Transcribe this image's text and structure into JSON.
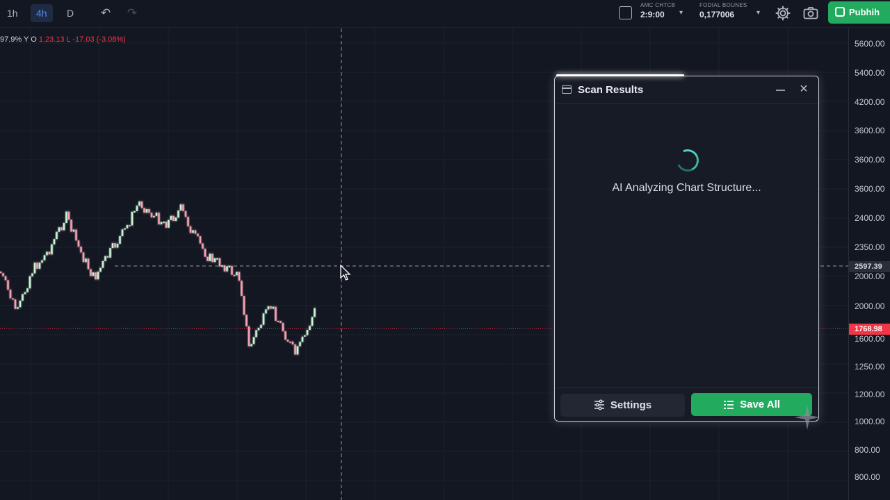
{
  "toolbar": {
    "timeframes": [
      {
        "label": "1h",
        "active": false
      },
      {
        "label": "4h",
        "active": true
      },
      {
        "label": "D",
        "active": false
      }
    ],
    "field1": {
      "label": "AMC CHTCB",
      "value": "2:9:00"
    },
    "field2": {
      "label": "FODIAL BOUNES",
      "value": "0,177006"
    },
    "publish_label": "Pubhih"
  },
  "legend": {
    "ohlc_left": "97.9% Y O",
    "ohlc_right": "1.23.13 L -17.03 (-3.08%)"
  },
  "price_axis": {
    "ticks": [
      "5600.00",
      "5400.00",
      "4200.00",
      "3600.00",
      "3600.00",
      "3600.00",
      "2400.00",
      "2350.00",
      "2000.00",
      "2000.00",
      "1600.00",
      "1250.00",
      "1200.00",
      "1000.00",
      "800.00",
      "800.00"
    ],
    "crosshair_price": "2597.39",
    "last_price": "1768.98"
  },
  "scan_panel": {
    "title": "Scan Results",
    "status": "AI Analyzing Chart Structure...",
    "settings_label": "Settings",
    "save_label": "Save All"
  },
  "colors": {
    "background": "#131722",
    "up_candle": "#c9f5d6",
    "down_candle": "#f5a3b3",
    "accent_green": "#22ab5f",
    "last_price_red": "#f23645"
  }
}
